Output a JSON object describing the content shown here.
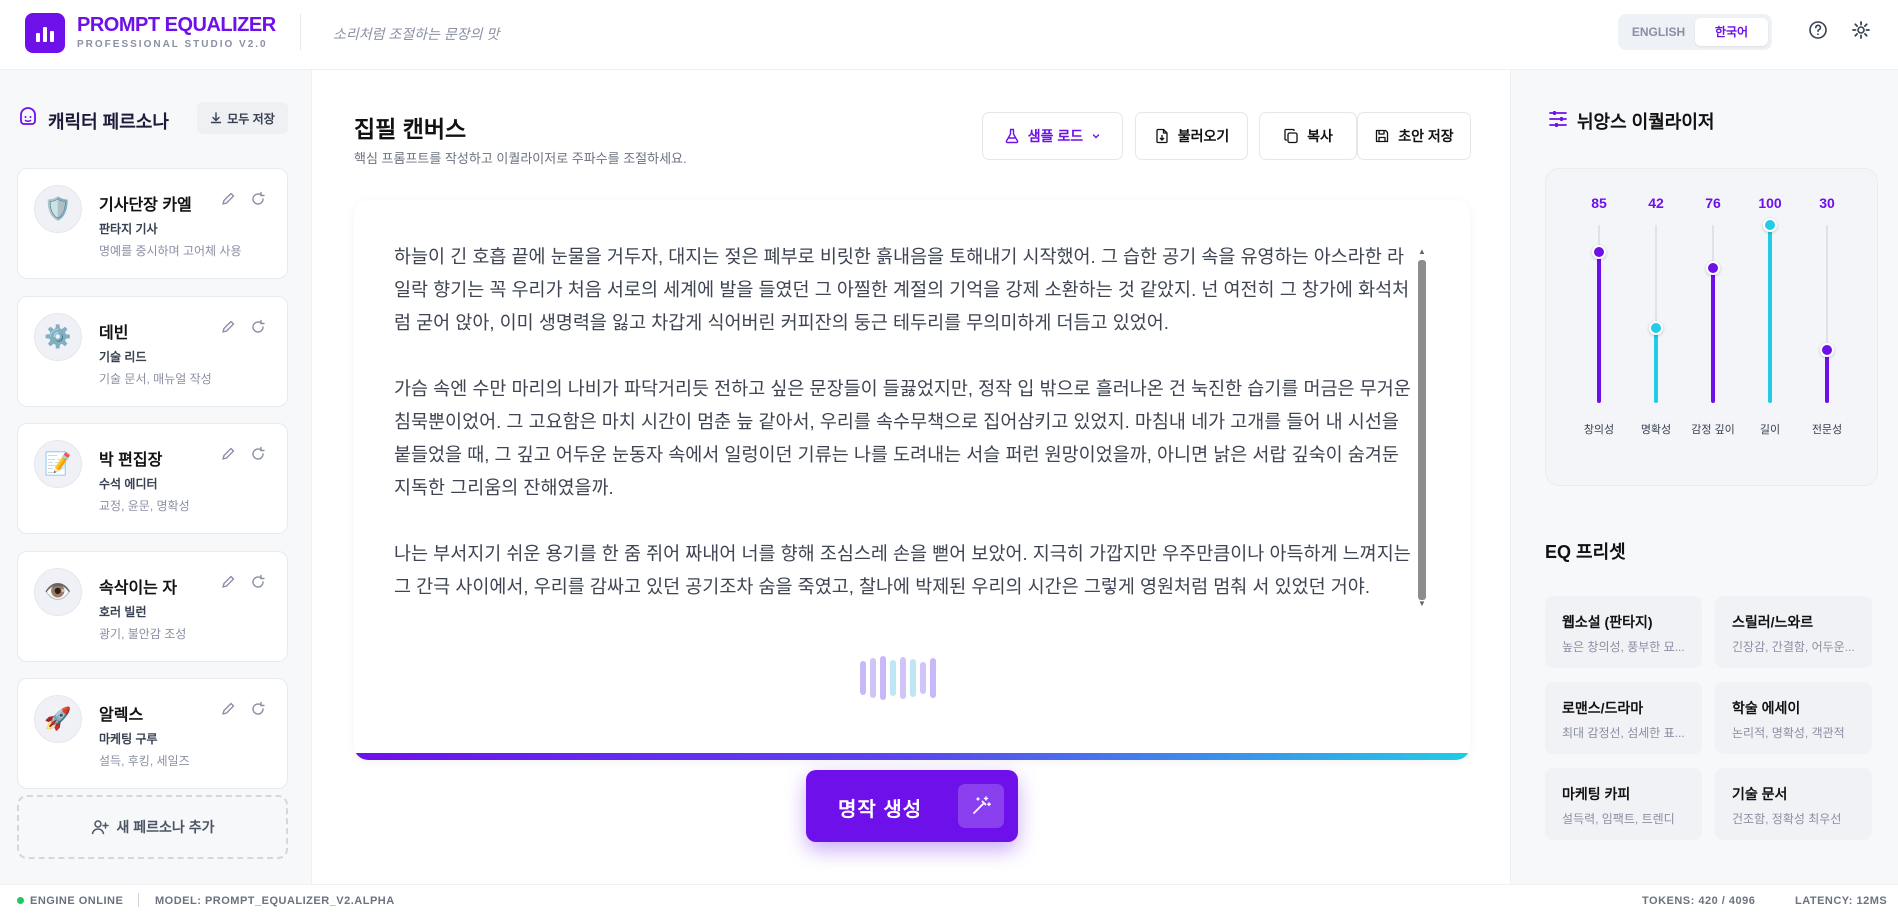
{
  "header": {
    "brand": "PROMPT EQUALIZER",
    "subtitle": "PROFESSIONAL STUDIO V2.0",
    "tagline": "소리처럼 조절하는 문장의 맛",
    "languages": [
      "ENGLISH",
      "한국어"
    ],
    "active_language": "한국어",
    "icons": [
      "help-icon",
      "gear-icon"
    ]
  },
  "left_sidebar": {
    "title": "캐릭터 페르소나",
    "save_all_label": "모두 저장",
    "personas": [
      {
        "name": "기사단장 카엘",
        "role": "판타지 기사",
        "desc": "명예를 중시하며 고어체 사용",
        "icon": "shield-icon",
        "glyph": "🛡️"
      },
      {
        "name": "데빈",
        "role": "기술 리드",
        "desc": "기술 문서, 매뉴얼 작성",
        "icon": "gear-icon",
        "glyph": "⚙️"
      },
      {
        "name": "박 편집장",
        "role": "수석 에디터",
        "desc": "교정, 윤문, 명확성",
        "icon": "memo-icon",
        "glyph": "📝"
      },
      {
        "name": "속삭이는 자",
        "role": "호러 빌런",
        "desc": "광기, 불안감 조성",
        "icon": "eye-icon",
        "glyph": "👁️"
      },
      {
        "name": "알렉스",
        "role": "마케팅 구루",
        "desc": "설득, 후킹, 세일즈",
        "icon": "rocket-icon",
        "glyph": "🚀"
      }
    ],
    "add_label": "새 페르소나 추가"
  },
  "main": {
    "title": "집필 캔버스",
    "subtitle": "핵심 프롬프트를 작성하고 이퀄라이저로 주파수를 조절하세요.",
    "toolbar": {
      "load_sample": "샘플 로드",
      "import": "불러오기",
      "copy": "복사",
      "save_draft": "초안 저장"
    },
    "paragraphs": [
      "하늘이 긴 호흡 끝에 눈물을 거두자, 대지는 젖은 폐부로 비릿한 흙내음을 토해내기 시작했어. 그 습한 공기 속을 유영하는 아스라한 라일락 향기는 꼭 우리가 처음 서로의 세계에 발을 들였던 그 아찔한 계절의 기억을 강제 소환하는 것 같았지. 넌 여전히 그 창가에 화석처럼 굳어 앉아, 이미 생명력을 잃고 차갑게 식어버린 커피잔의 둥근 테두리를 무의미하게 더듬고 있었어.",
      "가슴 속엔 수만 마리의 나비가 파닥거리듯 전하고 싶은 문장들이 들끓었지만, 정작 입 밖으로 흘러나온 건 눅진한 습기를 머금은 무거운 침묵뿐이었어. 그 고요함은 마치 시간이 멈춘 늪 같아서, 우리를 속수무책으로 집어삼키고 있었지. 마침내 네가 고개를 들어 내 시선을 붙들었을 때, 그 깊고 어두운 눈동자 속에서 일렁이던 기류는 나를 도려내는 서슬 퍼런 원망이었을까, 아니면 낡은 서랍 깊숙이 숨겨둔 지독한 그리움의 잔해였을까.",
      "나는 부서지기 쉬운 용기를 한 줌 쥐어 짜내어 너를 향해 조심스레 손을 뻗어 보았어. 지극히 가깝지만 우주만큼이나 아득하게 느껴지는 그 간극 사이에서, 우리를 감싸고 있던 공기조차 숨을 죽였고, 찰나에 박제된 우리의 시간은 그렇게 영원처럼 멈춰 서 있었던 거야."
    ],
    "generate_label": "명작 생성"
  },
  "right_sidebar": {
    "eq_title": "뉘앙스 이퀄라이저",
    "sliders": [
      {
        "label": "창의성",
        "value": 85,
        "color": "#6d10ea"
      },
      {
        "label": "명확성",
        "value": 42,
        "color": "#22cbe6"
      },
      {
        "label": "감정 깊이",
        "value": 76,
        "color": "#6d10ea"
      },
      {
        "label": "길이",
        "value": 100,
        "color": "#22cbe6"
      },
      {
        "label": "전문성",
        "value": 30,
        "color": "#6d10ea"
      }
    ],
    "preset_title": "EQ 프리셋",
    "presets": [
      {
        "name": "웹소설 (판타지)",
        "desc": "높은 창의성, 풍부한 묘..."
      },
      {
        "name": "스릴러/느와르",
        "desc": "긴장감, 간결함, 어두운..."
      },
      {
        "name": "로맨스/드라마",
        "desc": "최대 감정선, 섬세한 표..."
      },
      {
        "name": "학술 에세이",
        "desc": "논리적, 명확성, 객관적"
      },
      {
        "name": "마케팅 카피",
        "desc": "설득력, 임팩트, 트렌디"
      },
      {
        "name": "기술 문서",
        "desc": "건조함, 정확성 최우선"
      }
    ]
  },
  "footer": {
    "status": "ENGINE ONLINE",
    "model": "MODEL: PROMPT_EQUALIZER_V2.ALPHA",
    "tokens": "TOKENS: 420 / 4096",
    "latency": "LATENCY: 12MS"
  },
  "colors": {
    "accent": "#6d10ea",
    "cyan": "#22cbe6",
    "online": "#22c55e"
  }
}
